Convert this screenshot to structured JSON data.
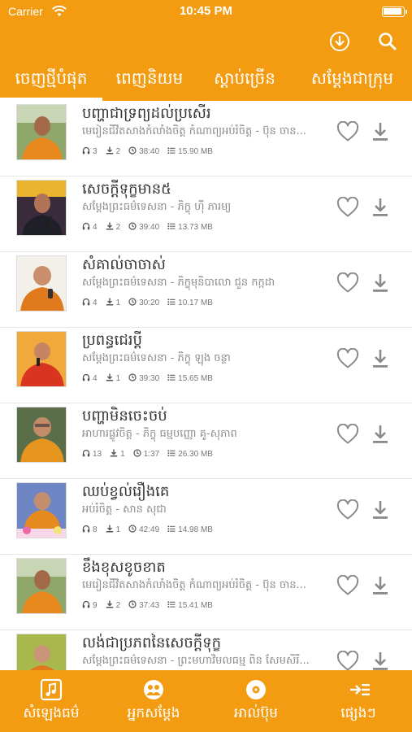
{
  "status_bar": {
    "carrier": "Carrier",
    "time": "10:45 PM"
  },
  "tabs": [
    "ចេញថ្មីបំផុត",
    "ពេញនិយម",
    "ស្តាប់ច្រើន",
    "សម្តែងជាក្រុម"
  ],
  "active_tab": 0,
  "colors": {
    "accent": "#f39c12",
    "text": "#333333",
    "muted": "#8a8a8a"
  },
  "items": [
    {
      "title": "បញ្ហាជាទ្រព្យដល់ប្រសើរ",
      "subtitle": "មេរៀនជីវិតសាងកំលាំងចិត្ត កំណាព្យអប់រំចិត្ត - ប៊ុន ចាន...",
      "listens": "3",
      "downloads": "2",
      "duration": "38:40",
      "size": "15.90 MB"
    },
    {
      "title": "សេចក្តីទុក្ខមាន៥",
      "subtitle": "សម្តែងព្រះធម៌ទេសនា - ភិក្ខុ ហ៊ឺ ភារម្យ",
      "listens": "4",
      "downloads": "2",
      "duration": "39:40",
      "size": "13.73 MB"
    },
    {
      "title": "សំគាល់ចាចាស់",
      "subtitle": "សម្តែងព្រះធម៌ទេសនា - ភិក្ខុមុនិបាលោ ជួន កក្កដា",
      "listens": "4",
      "downloads": "1",
      "duration": "30:20",
      "size": "10.17 MB"
    },
    {
      "title": "ប្រពន្ធជេរប្តី",
      "subtitle": "សម្តែងព្រះធម៌ទេសនា - ភិក្ខុ ឡុង ចន្ថា",
      "listens": "4",
      "downloads": "1",
      "duration": "39:30",
      "size": "15.65 MB"
    },
    {
      "title": "បញ្ហាមិនចេះចប់",
      "subtitle": "អាហារផ្លូវចិត្ត - ភិក្ខុ ធម្មបញ្ញោ គូ-សុភាព",
      "listens": "13",
      "downloads": "1",
      "duration": "1:37",
      "size": "26.30 MB"
    },
    {
      "title": "ឈប់ខ្វល់រឿងគេ",
      "subtitle": "អប់រំចិត្ត - សាន សុជា",
      "listens": "8",
      "downloads": "1",
      "duration": "42:49",
      "size": "14.98 MB"
    },
    {
      "title": "ខឹងខុសខូចខាត",
      "subtitle": "មេរៀនជីវិតសាងកំលាំងចិត្ត កំណាព្យអប់រំចិត្ត - ប៊ុន ចាន...",
      "listens": "9",
      "downloads": "2",
      "duration": "37:43",
      "size": "15.41 MB"
    },
    {
      "title": "លង់ជាប្រភពនៃសេចក្តីទុក្ខ",
      "subtitle": "សម្តែងព្រះធម៌ទេសនា - ព្រះមហាវិមលធម្ម ពិន សែមសិរី...",
      "listens": "",
      "downloads": "",
      "duration": "",
      "size": ""
    }
  ],
  "bottom_tabs": [
    {
      "label": "សំឡេងធម៌",
      "icon": "music-note-icon"
    },
    {
      "label": "អ្នកសម្តែង",
      "icon": "people-icon"
    },
    {
      "label": "អាល់ប៊ុម",
      "icon": "album-disc-icon"
    },
    {
      "label": "ផ្សេងៗ",
      "icon": "more-list-icon"
    }
  ]
}
